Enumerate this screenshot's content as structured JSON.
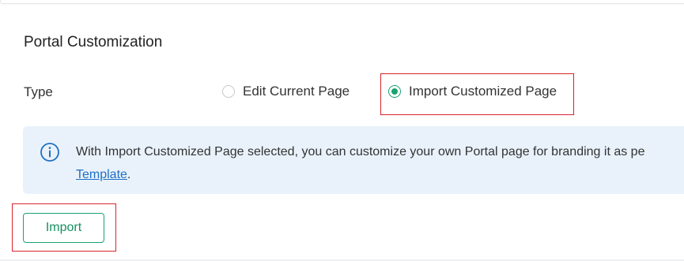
{
  "section": {
    "title": "Portal Customization"
  },
  "type_field": {
    "label": "Type",
    "options": [
      {
        "label": "Edit Current Page",
        "selected": false
      },
      {
        "label": "Import Customized Page",
        "selected": true
      }
    ]
  },
  "info": {
    "icon": "info-icon",
    "text": "With Import Customized Page selected, you can customize your own Portal page for branding it as pe",
    "link_label": "Template",
    "link_suffix": "."
  },
  "actions": {
    "import_label": "Import"
  },
  "colors": {
    "accent_green": "#1aa36e",
    "info_background": "#e9f2fb",
    "link_blue": "#1f6fc5",
    "highlight_red": "#d9232b"
  }
}
